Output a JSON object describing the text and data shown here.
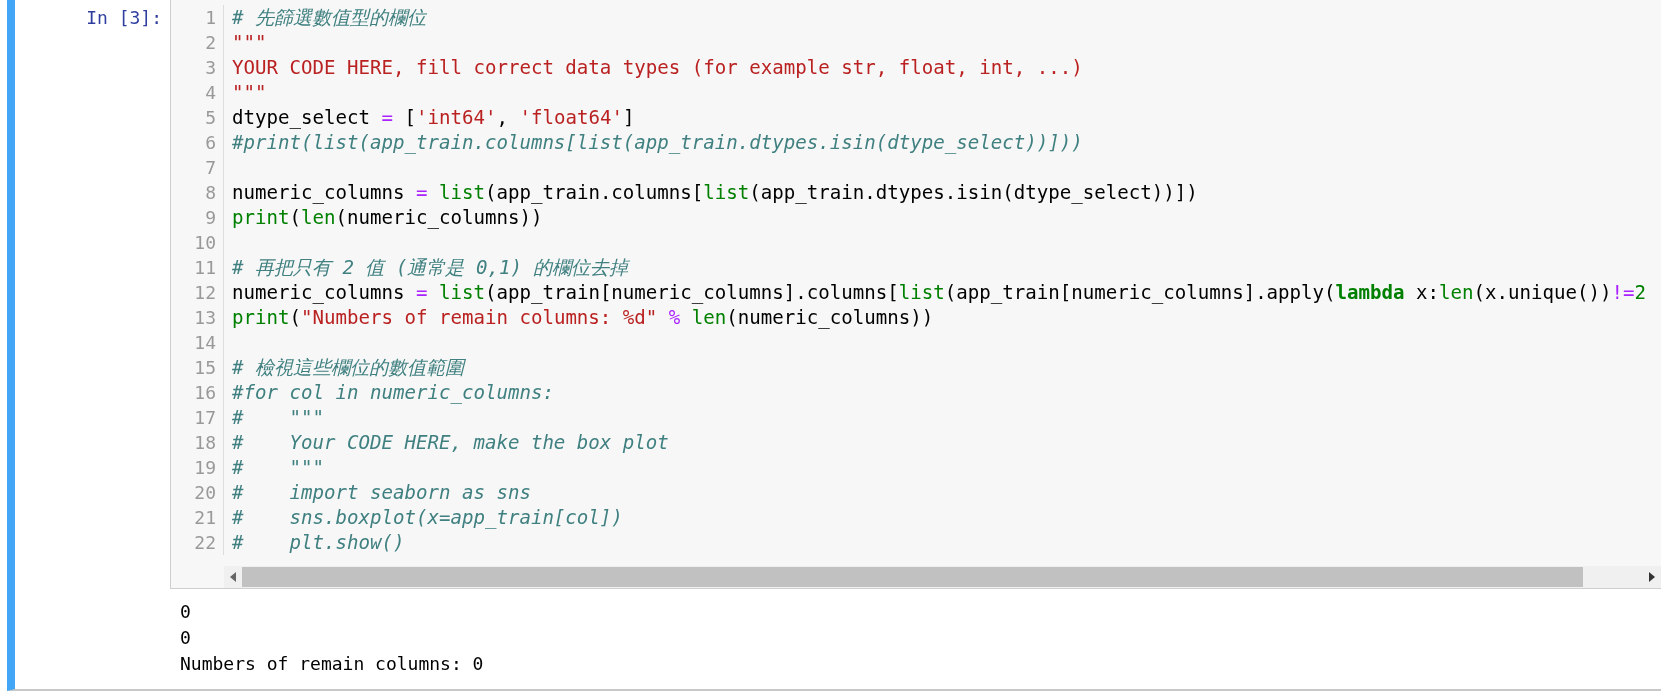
{
  "cell": {
    "prompt": "In [3]:",
    "lines": [
      {
        "number": "1",
        "tokens": [
          {
            "kind": "comment",
            "text": "# 先篩選數值型的欄位"
          }
        ]
      },
      {
        "number": "2",
        "tokens": [
          {
            "kind": "string",
            "text": "\"\"\""
          }
        ]
      },
      {
        "number": "3",
        "tokens": [
          {
            "kind": "string",
            "text": "YOUR CODE HERE, fill correct data types (for example str, float, int, ...)"
          }
        ]
      },
      {
        "number": "4",
        "tokens": [
          {
            "kind": "string",
            "text": "\"\"\""
          }
        ]
      },
      {
        "number": "5",
        "tokens": [
          {
            "kind": "plain",
            "text": "dtype_select "
          },
          {
            "kind": "operator",
            "text": "="
          },
          {
            "kind": "plain",
            "text": " ["
          },
          {
            "kind": "string",
            "text": "'int64'"
          },
          {
            "kind": "plain",
            "text": ", "
          },
          {
            "kind": "string",
            "text": "'float64'"
          },
          {
            "kind": "plain",
            "text": "]"
          }
        ]
      },
      {
        "number": "6",
        "tokens": [
          {
            "kind": "comment",
            "text": "#print(list(app_train.columns[list(app_train.dtypes.isin(dtype_select))]))"
          }
        ]
      },
      {
        "number": "7"
      },
      {
        "number": "8",
        "tokens": [
          {
            "kind": "plain",
            "text": "numeric_columns "
          },
          {
            "kind": "operator",
            "text": "= "
          },
          {
            "kind": "builtin",
            "text": "list"
          },
          {
            "kind": "plain",
            "text": "(app_train.columns["
          },
          {
            "kind": "builtin",
            "text": "list"
          },
          {
            "kind": "plain",
            "text": "(app_train.dtypes.isin(dtype_select))])"
          }
        ]
      },
      {
        "number": "9",
        "tokens": [
          {
            "kind": "builtin",
            "text": "print"
          },
          {
            "kind": "plain",
            "text": "("
          },
          {
            "kind": "builtin",
            "text": "len"
          },
          {
            "kind": "plain",
            "text": "(numeric_columns))"
          }
        ]
      },
      {
        "number": "10"
      },
      {
        "number": "11",
        "tokens": [
          {
            "kind": "comment",
            "text": "# 再把只有 2 值 (通常是 0,1) 的欄位去掉"
          }
        ]
      },
      {
        "number": "12",
        "tokens": [
          {
            "kind": "plain",
            "text": "numeric_columns "
          },
          {
            "kind": "operator",
            "text": "= "
          },
          {
            "kind": "builtin",
            "text": "list"
          },
          {
            "kind": "plain",
            "text": "(app_train[numeric_columns].columns["
          },
          {
            "kind": "builtin",
            "text": "list"
          },
          {
            "kind": "plain",
            "text": "(app_train[numeric_columns].apply("
          },
          {
            "kind": "keyword",
            "text": "lambda"
          },
          {
            "kind": "plain",
            "text": " x:"
          },
          {
            "kind": "builtin",
            "text": "len"
          },
          {
            "kind": "plain",
            "text": "(x.unique())"
          },
          {
            "kind": "operator",
            "text": "!="
          },
          {
            "kind": "number",
            "text": "2"
          }
        ]
      },
      {
        "number": "13",
        "tokens": [
          {
            "kind": "builtin",
            "text": "print"
          },
          {
            "kind": "plain",
            "text": "("
          },
          {
            "kind": "string",
            "text": "\"Numbers of remain columns: %d\""
          },
          {
            "kind": "operator",
            "text": " % "
          },
          {
            "kind": "builtin",
            "text": "len"
          },
          {
            "kind": "plain",
            "text": "(numeric_columns))"
          }
        ]
      },
      {
        "number": "14"
      },
      {
        "number": "15",
        "tokens": [
          {
            "kind": "comment",
            "text": "# 檢視這些欄位的數值範圍"
          }
        ]
      },
      {
        "number": "16",
        "tokens": [
          {
            "kind": "comment",
            "text": "#for col in numeric_columns:"
          }
        ]
      },
      {
        "number": "17",
        "tokens": [
          {
            "kind": "comment",
            "text": "#    \"\"\""
          }
        ]
      },
      {
        "number": "18",
        "tokens": [
          {
            "kind": "comment",
            "text": "#    Your CODE HERE, make the box plot"
          }
        ]
      },
      {
        "number": "19",
        "tokens": [
          {
            "kind": "comment",
            "text": "#    \"\"\""
          }
        ]
      },
      {
        "number": "20",
        "tokens": [
          {
            "kind": "comment",
            "text": "#    import seaborn as sns"
          }
        ]
      },
      {
        "number": "21",
        "tokens": [
          {
            "kind": "comment",
            "text": "#    sns.boxplot(x=app_train[col])"
          }
        ]
      },
      {
        "number": "22",
        "tokens": [
          {
            "kind": "comment",
            "text": "#    plt.show()"
          }
        ]
      }
    ]
  },
  "output": [
    "0",
    "0",
    "Numbers of remain columns: 0"
  ]
}
